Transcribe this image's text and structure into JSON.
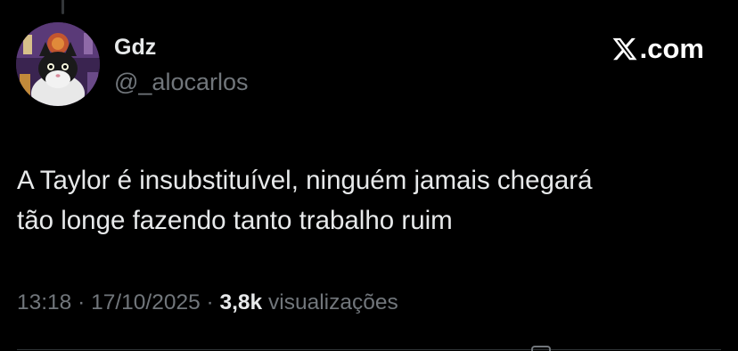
{
  "author": {
    "display_name": "Gdz",
    "handle": "@_alocarlos",
    "avatar_icon": "cat-avatar-icon"
  },
  "brand": {
    "logo_icon": "x-logo-icon",
    "logo_text": ".com"
  },
  "tweet": {
    "lines": [
      "A Taylor é insubstituível, ninguém jamais chegará",
      "tão longe fazendo tanto trabalho ruim"
    ]
  },
  "meta": {
    "time": "13:18",
    "sep1": " · ",
    "date": "17/10/2025",
    "sep2": " · ",
    "views_count": "3,8k",
    "views_label": " visualizações"
  },
  "colors": {
    "background": "#000000",
    "primary_text": "#e7e9ea",
    "secondary_text": "#71767b"
  }
}
